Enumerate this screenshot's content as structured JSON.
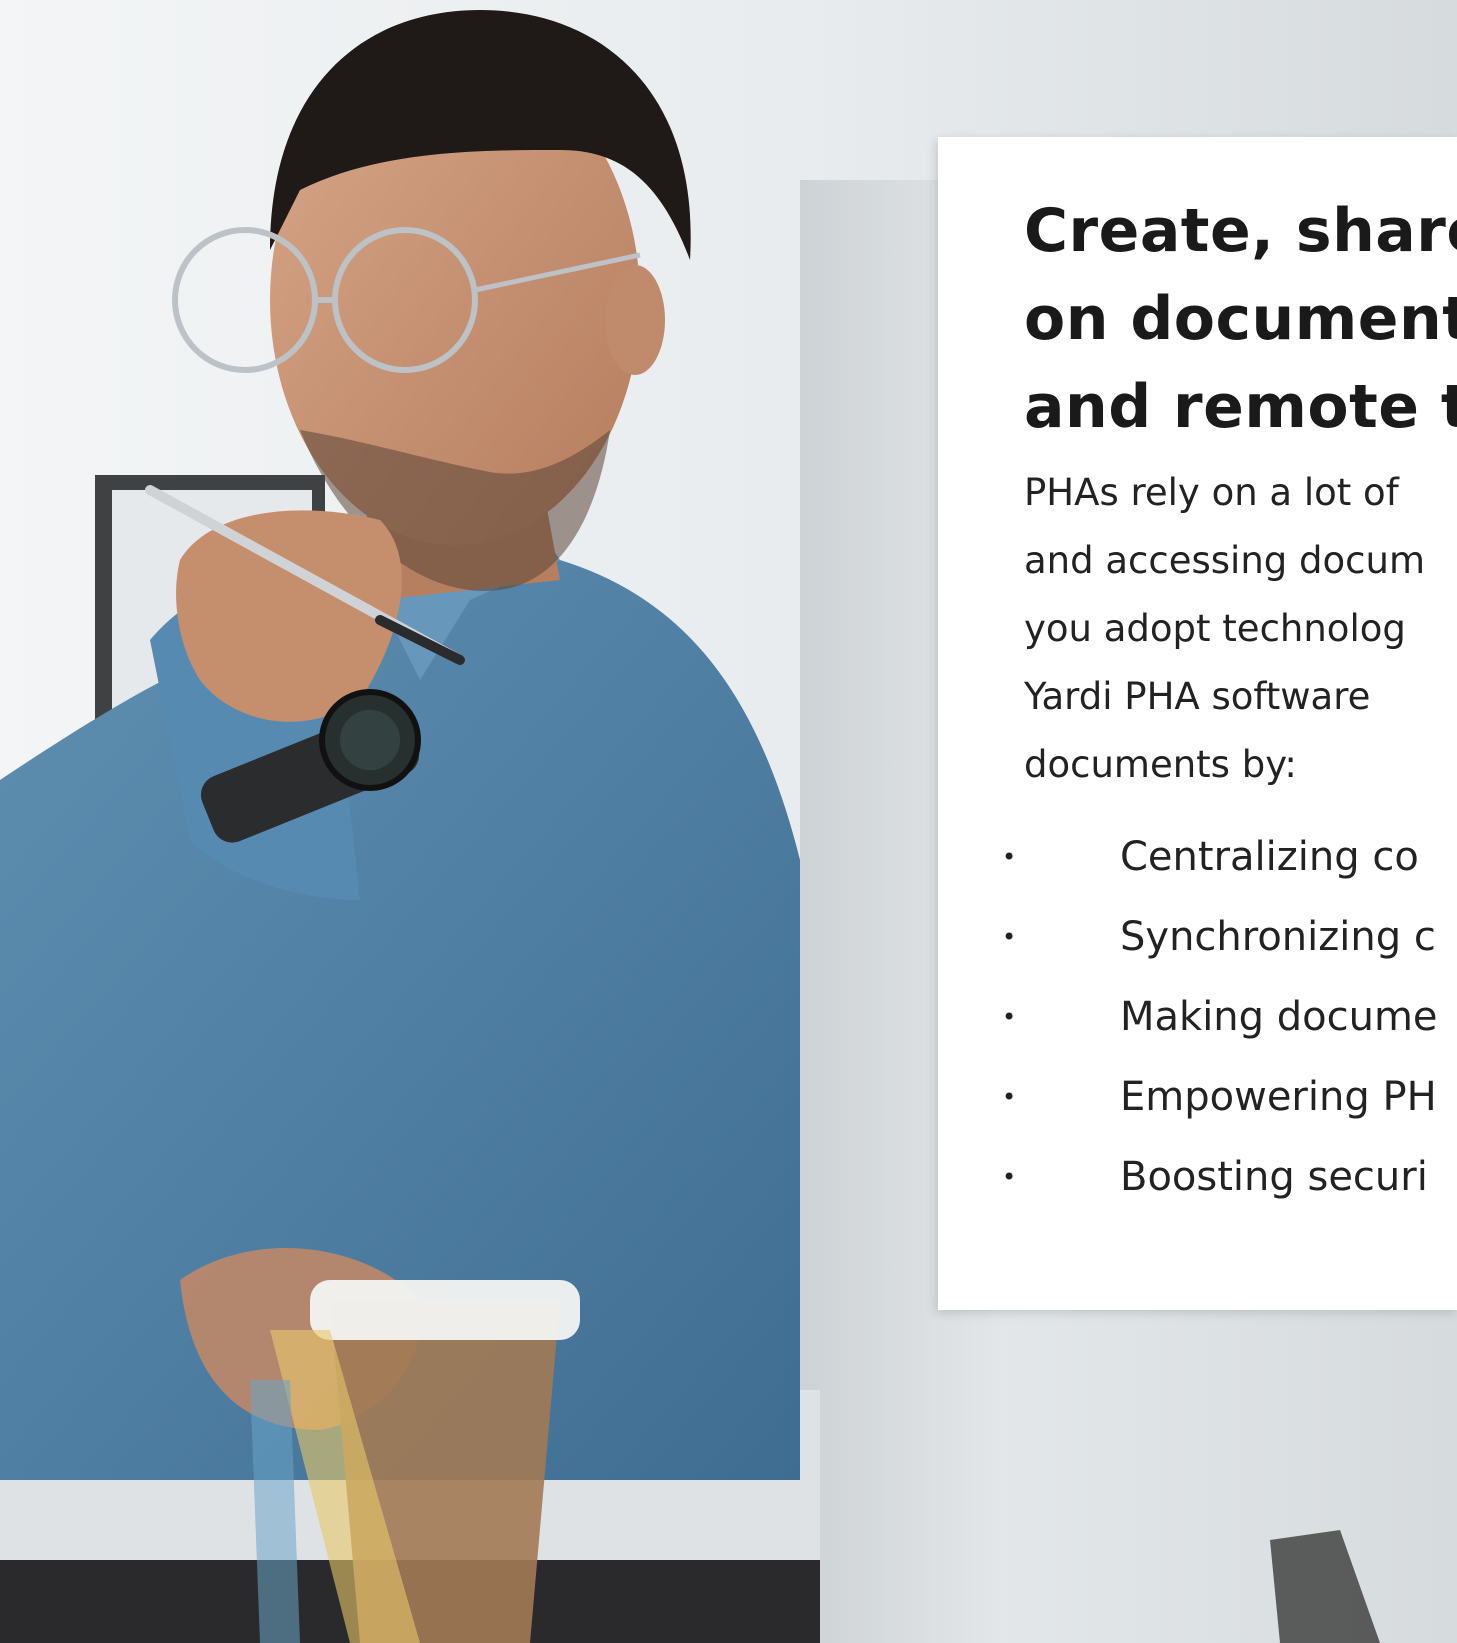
{
  "card": {
    "headline": [
      "Create, share",
      "on documents",
      "and remote te"
    ],
    "body": [
      "PHAs rely on a lot of",
      "and accessing docum",
      "you adopt technolog",
      "Yardi PHA software",
      "documents by:"
    ],
    "bullets": [
      "Centralizing co",
      "Synchronizing c",
      "Making docume",
      "Empowering PH",
      "Boosting securi"
    ]
  }
}
